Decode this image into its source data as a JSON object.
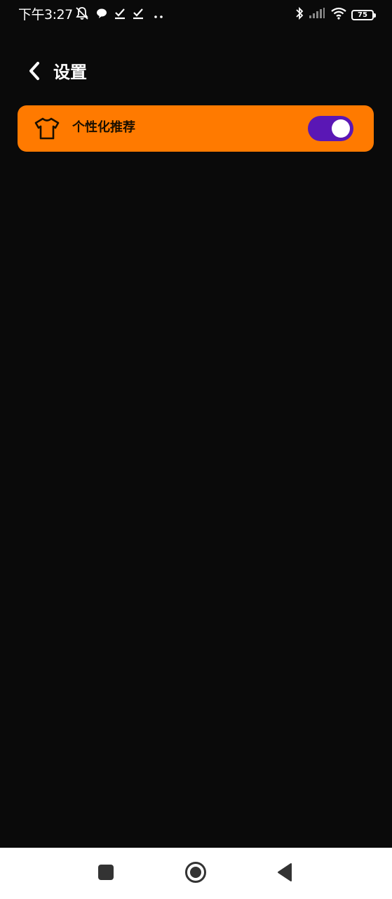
{
  "status_bar": {
    "time": "下午3:27",
    "battery_level": "75",
    "left_icons": [
      "bell-muted-icon",
      "chat-bubble-icon",
      "check-icon",
      "check-icon",
      "more-dots-icon"
    ],
    "right_icons": [
      "bluetooth-icon",
      "signal-icon",
      "wifi-icon",
      "battery-icon"
    ]
  },
  "header": {
    "title": "设置",
    "back_icon": "chevron-left-icon"
  },
  "settings": {
    "items": [
      {
        "icon": "tshirt-icon",
        "label": "个性化推荐",
        "toggle_on": true
      }
    ]
  },
  "nav_bar": {
    "buttons": [
      "recent-apps-icon",
      "home-icon",
      "back-triangle-icon"
    ]
  },
  "colors": {
    "background": "#0a0a0a",
    "row_accent": "#ff7a00",
    "toggle_on": "#5a17b5",
    "nav_bar": "#ffffff"
  }
}
